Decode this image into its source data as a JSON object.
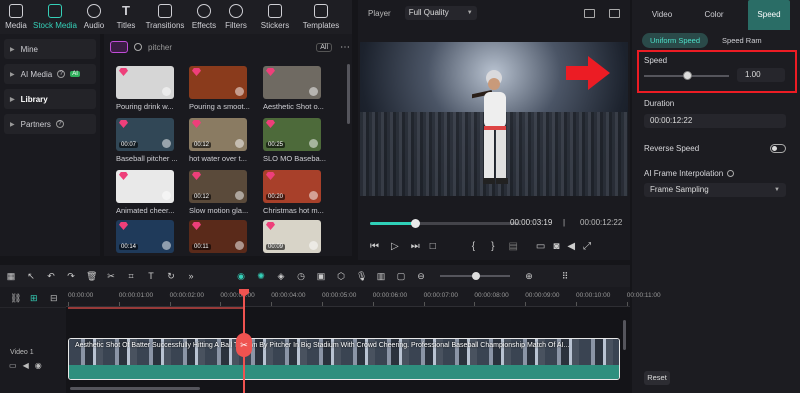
{
  "toolbar": {
    "items": [
      {
        "label": "Media",
        "icon": "media-icon"
      },
      {
        "label": "Stock Media",
        "icon": "stock-media-icon",
        "active": true
      },
      {
        "label": "Audio",
        "icon": "audio-icon"
      },
      {
        "label": "Titles",
        "icon": "titles-icon"
      },
      {
        "label": "Transitions",
        "icon": "transitions-icon"
      },
      {
        "label": "Effects",
        "icon": "effects-icon"
      },
      {
        "label": "Filters",
        "icon": "filters-icon"
      },
      {
        "label": "Stickers",
        "icon": "stickers-icon"
      },
      {
        "label": "Templates",
        "icon": "templates-icon"
      }
    ]
  },
  "sidebar": {
    "items": [
      {
        "label": "Mine"
      },
      {
        "label": "AI Media",
        "badge": "AI"
      },
      {
        "label": "Library"
      },
      {
        "label": "Partners"
      }
    ]
  },
  "media": {
    "search_value": "pitcher",
    "all_label": "All",
    "items": [
      {
        "label": "Pouring drink w...",
        "color": "#d6d6d6"
      },
      {
        "label": "Pouring a smoot...",
        "color": "#8a3b1c"
      },
      {
        "label": "Aesthetic Shot o...",
        "color": "#6f6a62"
      },
      {
        "label": "Baseball pitcher ...",
        "color": "#314756",
        "duration": "00:07"
      },
      {
        "label": "hot water over t...",
        "color": "#8a7b62",
        "duration": "00:12"
      },
      {
        "label": "SLO MO Baseba...",
        "color": "#4d6a3a",
        "duration": "00:25"
      },
      {
        "label": "Animated cheer...",
        "color": "#e9e9e9"
      },
      {
        "label": "Slow motion gla...",
        "color": "#5a4a3a",
        "duration": "00:12"
      },
      {
        "label": "Christmas hot m...",
        "color": "#a8402a",
        "duration": "00:20"
      },
      {
        "label": "",
        "color": "#1f3a5a",
        "duration": "00:14"
      },
      {
        "label": "",
        "color": "#5a2a1a",
        "duration": "00:11"
      },
      {
        "label": "",
        "color": "#d8d4c8",
        "duration": "00:09"
      }
    ]
  },
  "player": {
    "label": "Player",
    "quality": "Full Quality",
    "current_time": "00:00:03:19",
    "total_time": "00:00:12:22",
    "progress": 0.3
  },
  "right_panel": {
    "tabs": [
      "Video",
      "Color",
      "Speed"
    ],
    "subtabs": [
      "Uniform Speed",
      "Speed Ram"
    ],
    "speed_label": "Speed",
    "speed_value": "1.00",
    "speed_slider": 0.5,
    "duration_label": "Duration",
    "duration_value": "00:00:12:22",
    "reverse_label": "Reverse Speed",
    "interp_label": "AI Frame Interpolation",
    "interp_value": "Frame Sampling",
    "reset_label": "Reset"
  },
  "timeline": {
    "ruler": [
      "00:00:00",
      "00:00:01:00",
      "00:00:02:00",
      "00:00:03:00",
      "00:00:04:00",
      "00:00:05:00",
      "00:00:06:00",
      "00:00:07:00",
      "00:00:08:00",
      "00:00:09:00",
      "00:00:10:00",
      "00:00:11:00"
    ],
    "track_label": "Video 1",
    "clip_title": "Aesthetic Shot Of Batter Successfully Hitting A Ball Thrown By Pitcher In Big Stadium With Crowd Cheering. Professional Baseball Championship Match Of AI..."
  },
  "colors": {
    "accent": "#35d0b8",
    "playhead": "#ef5350",
    "highlight_box": "#ec1c24"
  }
}
